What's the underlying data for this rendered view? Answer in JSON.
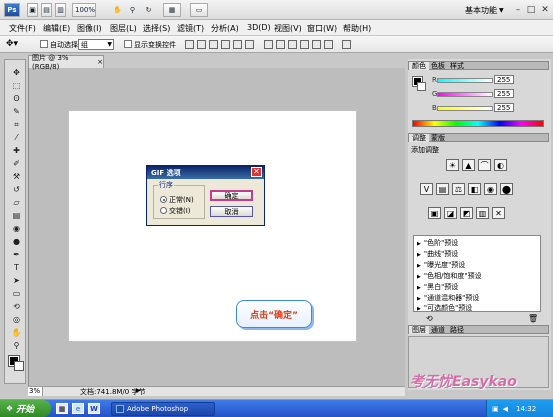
{
  "appbar": {
    "zoom_value": "100%",
    "workspace_label": "基本功能",
    "workspace_arrow": "▼",
    "min_glyph": "–",
    "max_glyph": "□",
    "close_glyph": "✕"
  },
  "menubar": {
    "items": [
      "文件(F)",
      "编辑(E)",
      "图像(I)",
      "图层(L)",
      "选择(S)",
      "滤镜(T)",
      "分析(A)",
      "3D(D)",
      "视图(V)",
      "窗口(W)",
      "帮助(H)"
    ]
  },
  "options": {
    "auto_select_label": "自动选择",
    "auto_select_value": "组",
    "show_transform_label": "显示变换控件"
  },
  "document": {
    "tab_title": "图片 @ 3%(RGB/8)",
    "tab_close": "×",
    "zoom_status": "3%",
    "doc_info": "文档:741.8M/0 字节"
  },
  "dialog": {
    "title": "GIF 选项",
    "close_glyph": "✕",
    "group_label": "行序",
    "option_normal": "正常(N)",
    "option_interlaced": "交错(I)",
    "ok_label": "确定",
    "cancel_label": "取消"
  },
  "callout": {
    "text": "点击“确定”"
  },
  "color_panel": {
    "tabs": [
      "颜色",
      "色板",
      "样式"
    ],
    "r_label": "R",
    "g_label": "G",
    "b_label": "B",
    "r_value": "255",
    "g_value": "255",
    "b_value": "255"
  },
  "adjust_panel": {
    "tabs": [
      "调整",
      "蒙版"
    ],
    "title": "添加调整",
    "presets": [
      "\"色阶\"预设",
      "\"曲线\"预设",
      "\"曝光度\"预设",
      "\"色相/饱和度\"预设",
      "\"黑白\"预设",
      "\"通道混和器\"预设",
      "\"可选颜色\"预设"
    ],
    "preset_arrow": "▶"
  },
  "layers_panel": {
    "tabs": [
      "图层",
      "通道",
      "路径"
    ]
  },
  "watermark": {
    "text": "考无忧Easykao"
  },
  "taskbar": {
    "start_label": "开始",
    "app_label": "Adobe Photoshop",
    "clock": "14:32"
  }
}
